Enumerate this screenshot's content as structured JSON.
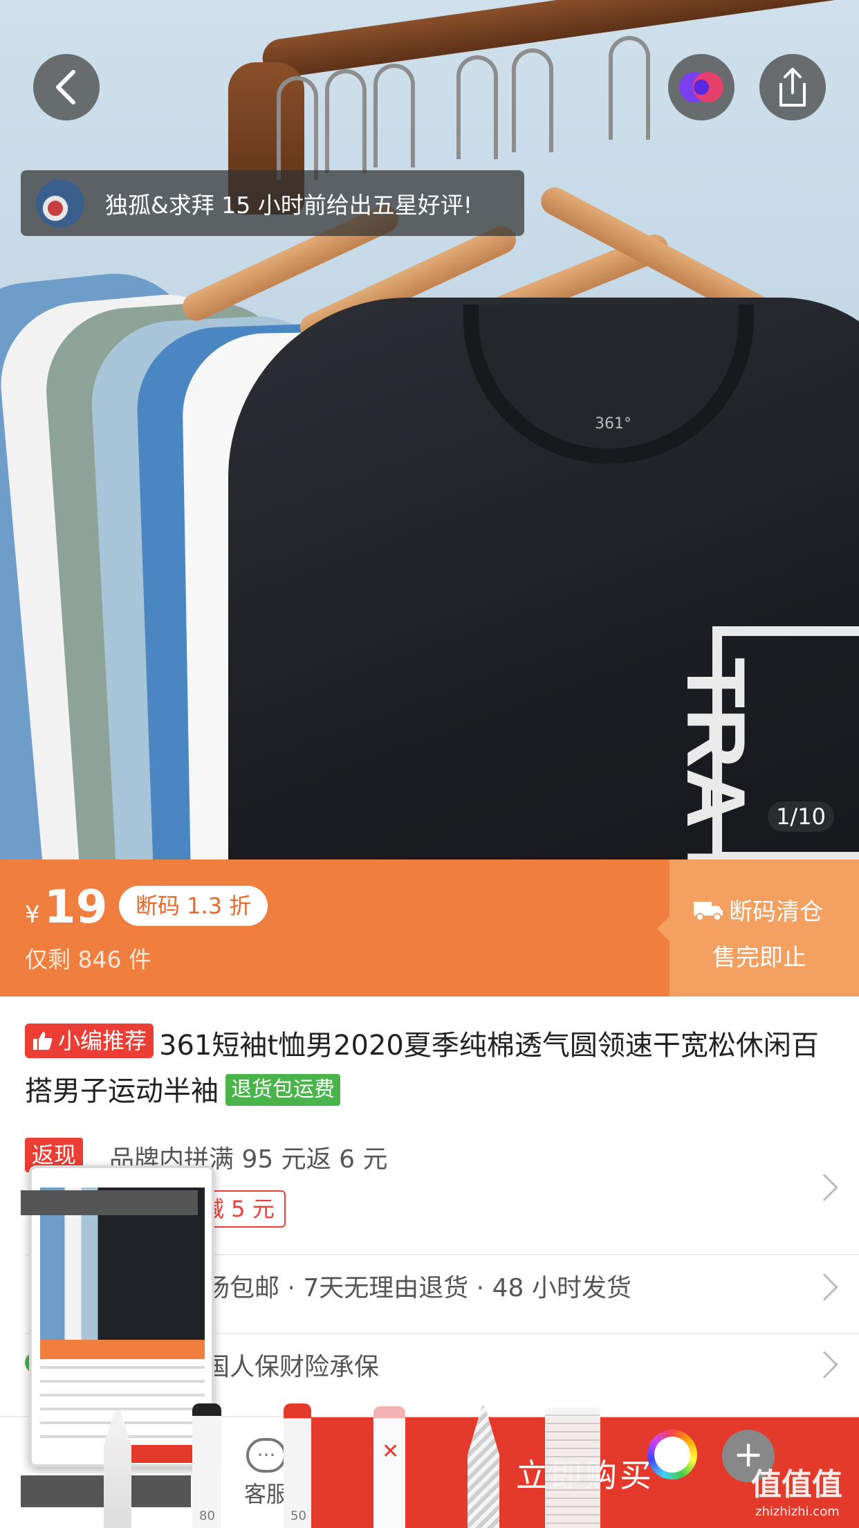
{
  "hero": {
    "image_counter": "1/10",
    "brand_tag": "361°",
    "print_text": "TRA FORA",
    "review_toast": "独孤&求拜 15 小时前给出五星好评!"
  },
  "price_bar": {
    "currency": "¥",
    "price": "19",
    "discount_badge": "断码 1.3 折",
    "stock": "仅剩 846 件",
    "clearance_title": "断码清仓",
    "clearance_sub": "售完即止"
  },
  "product": {
    "pick_badge": "小编推荐",
    "title": "361短袖t恤男2020夏季纯棉透气圆领速干宽松休闲百搭男子运动半袖",
    "return_badge": "退货包运费"
  },
  "promotions": {
    "rebate_tag": "返现",
    "rebate_text": "品牌内拼满 95 元返 6 元",
    "coupon_text": "减 5 元"
  },
  "services": {
    "text": "场包邮 · 7天无理由退货 · 48 小时发货",
    "insurance_text": "国人保财险承保"
  },
  "bottom_bar": {
    "service_label": "客服",
    "buy_label": "立即购买"
  },
  "markup_tools": {
    "marker_label": "80",
    "pen_label": "50"
  },
  "watermark": {
    "logo": "值值值",
    "url": "zhizhizhi.com"
  },
  "colors": {
    "price_orange": "#f07e3f",
    "clearance_orange": "#f4a061",
    "accent_red": "#e43a2c",
    "badge_green": "#49b44a"
  }
}
